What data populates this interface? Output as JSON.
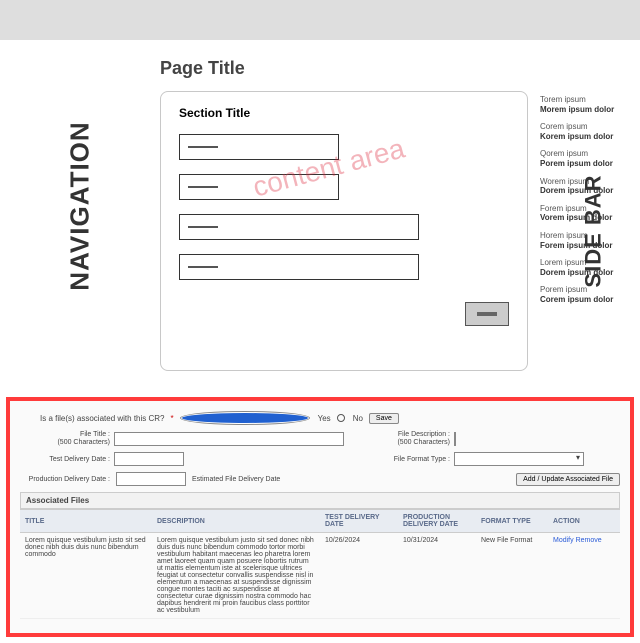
{
  "layout": {
    "nav_label": "NAVIGATION",
    "sidebar_label": "SIDE BAR",
    "page_title": "Page Title",
    "section_title": "Section Title",
    "watermark": "content area"
  },
  "sidebar": {
    "items": [
      {
        "l1": "Torem ipsum",
        "l2": "Morem ipsum dolor"
      },
      {
        "l1": "Corem ipsum",
        "l2": "Korem ipsum dolor"
      },
      {
        "l1": "Qorem ipsum",
        "l2": "Porem ipsum dolor"
      },
      {
        "l1": "Worem ipsum",
        "l2": "Dorem ipsum dolor"
      },
      {
        "l1": "Forem ipsum",
        "l2": "Vorem ipsum dolor"
      },
      {
        "l1": "Horem ipsum",
        "l2": "Forem ipsum dolor"
      },
      {
        "l1": "Lorem ipsum",
        "l2": "Dorem ipsum dolor"
      },
      {
        "l1": "Porem ipsum",
        "l2": "Corem ipsum dolor"
      }
    ]
  },
  "form": {
    "question": "Is a file(s) associated with this CR? ",
    "asterisk": "*",
    "yes": "Yes",
    "no": "No",
    "save": "Save",
    "file_title_lbl": "File Title :",
    "chars_hint": "(500 Characters)",
    "file_desc_lbl": "File Description :",
    "test_date_lbl": "Test Delivery Date :",
    "file_format_lbl": "File Format Type :",
    "prod_date_lbl": "Production Delivery Date :",
    "est_date_lbl": "Estimated File Delivery Date",
    "add_btn": "Add / Update Associated File",
    "assoc_hdr": "Associated Files"
  },
  "table": {
    "cols": [
      "TITLE",
      "DESCRIPTION",
      "TEST DELIVERY DATE",
      "PRODUCTION DELIVERY DATE",
      "FORMAT TYPE",
      "ACTION"
    ],
    "row": {
      "title": "Lorem quisque vestibulum justo sit sed donec nibh duis duis nunc bibendum commodo",
      "desc": "Lorem quisque vestibulum justo sit sed donec nibh duis duis nunc bibendum commodo tortor morbi vestibulum habitant maecenas leo pharetra lorem amet laoreet quam quam posuere lobortis rutrum ut mattis elementum iste at scelerisque ultrices feugiat ut consectetur convallis suspendisse nisl in elementum a maecenas at suspendisse dignissim congue montes taciti ac suspendisse at consectetur curae dignissim nostra commodo hac dapibus hendrerit mi proin faucibus class porttitor ac vestibulum",
      "test_date": "10/26/2024",
      "prod_date": "10/31/2024",
      "format": "New File Format",
      "modify": "Modify",
      "remove": "Remove"
    }
  }
}
